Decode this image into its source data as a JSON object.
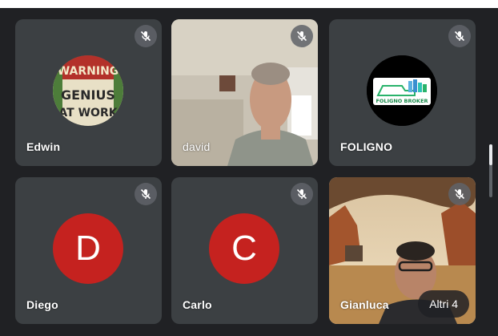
{
  "colors": {
    "background": "#202124",
    "tile": "#3c4043",
    "avatar": "#c5221f",
    "mute_badge": "#5f6368"
  },
  "participants": [
    {
      "name": "Edwin",
      "muted": true,
      "avatar_type": "image",
      "image_text": [
        "WARNING",
        "GENIUS",
        "AT WORK"
      ]
    },
    {
      "name": "david",
      "muted": true,
      "avatar_type": "video"
    },
    {
      "name": "FOLIGNO",
      "muted": true,
      "avatar_type": "image",
      "image_text": [
        "FOLIGNO BROKER"
      ]
    },
    {
      "name": "Diego",
      "muted": true,
      "avatar_type": "initial",
      "initial": "D"
    },
    {
      "name": "Carlo",
      "muted": true,
      "avatar_type": "initial",
      "initial": "C"
    },
    {
      "name": "Gianluca",
      "muted": true,
      "avatar_type": "video"
    }
  ],
  "more_participants": {
    "label": "Altri 4"
  },
  "icons": {
    "mute": "mic-off-icon"
  }
}
